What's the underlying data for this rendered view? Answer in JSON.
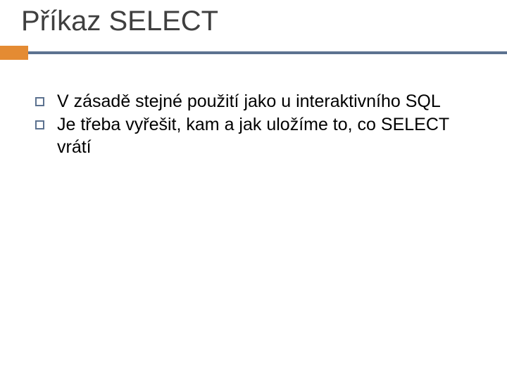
{
  "title": "Příkaz SELECT",
  "bullets": [
    "V zásadě stejné použití jako u interaktivního SQL",
    "Je třeba vyřešit, kam a jak uložíme to, co SELECT vrátí"
  ]
}
